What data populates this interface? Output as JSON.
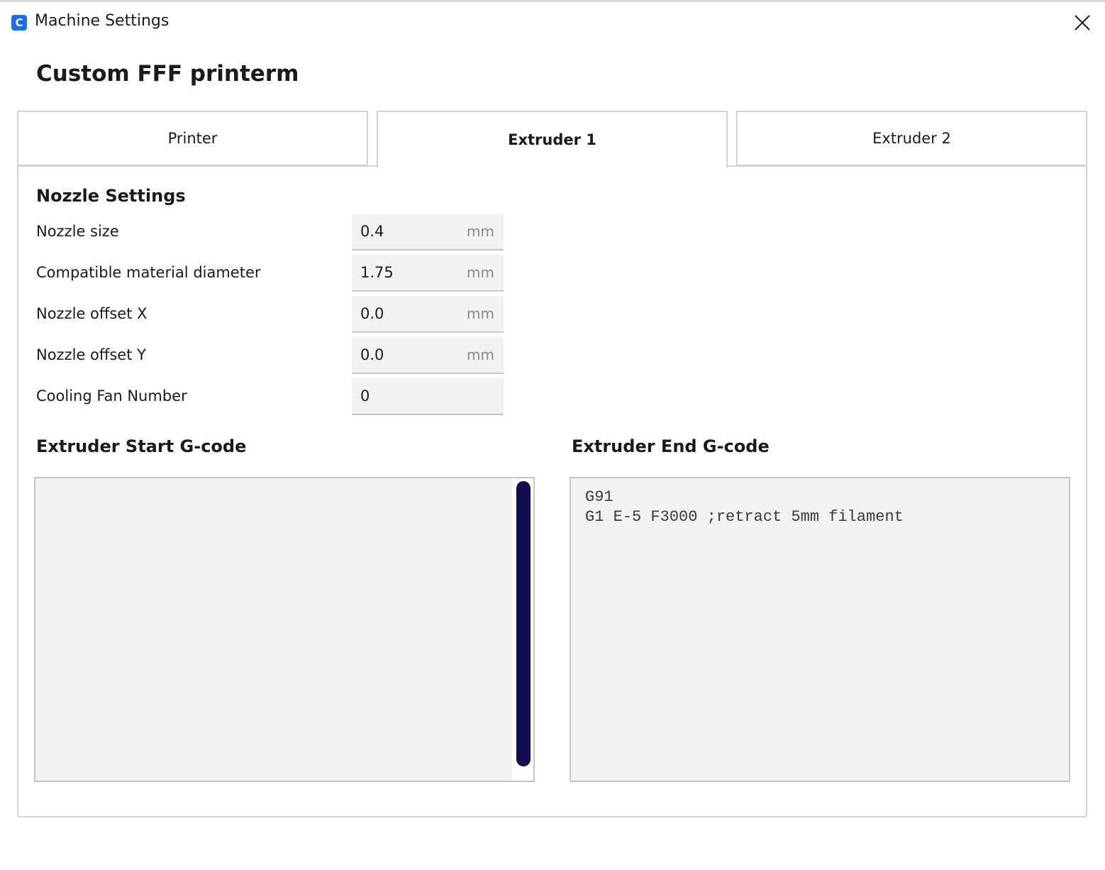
{
  "window": {
    "title": "Machine Settings",
    "app_icon_glyph": "C",
    "icons": {
      "app": "cura-app-icon",
      "close": "close-icon"
    }
  },
  "page": {
    "title": "Custom FFF printerm"
  },
  "tabs": [
    {
      "label": "Printer",
      "active": false
    },
    {
      "label": "Extruder 1",
      "active": true
    },
    {
      "label": "Extruder 2",
      "active": false
    }
  ],
  "nozzle": {
    "title": "Nozzle Settings",
    "fields": [
      {
        "label": "Nozzle size",
        "value": "0.4",
        "unit": "mm"
      },
      {
        "label": "Compatible material diameter",
        "value": "1.75",
        "unit": "mm"
      },
      {
        "label": "Nozzle offset X",
        "value": "0.0",
        "unit": "mm"
      },
      {
        "label": "Nozzle offset Y",
        "value": "0.0",
        "unit": "mm"
      },
      {
        "label": "Cooling Fan Number",
        "value": "0",
        "unit": ""
      }
    ]
  },
  "gcode": {
    "start": {
      "title": "Extruder Start G-code",
      "value": ""
    },
    "end": {
      "title": "Extruder End G-code",
      "value": "G91\nG1 E-5 F3000 ;retract 5mm filament"
    }
  },
  "colors": {
    "accent": "#196ef0",
    "scrollbar_thumb": "#0f0d4f",
    "field_bg": "#f2f2f2",
    "border": "#d2d2d2"
  }
}
